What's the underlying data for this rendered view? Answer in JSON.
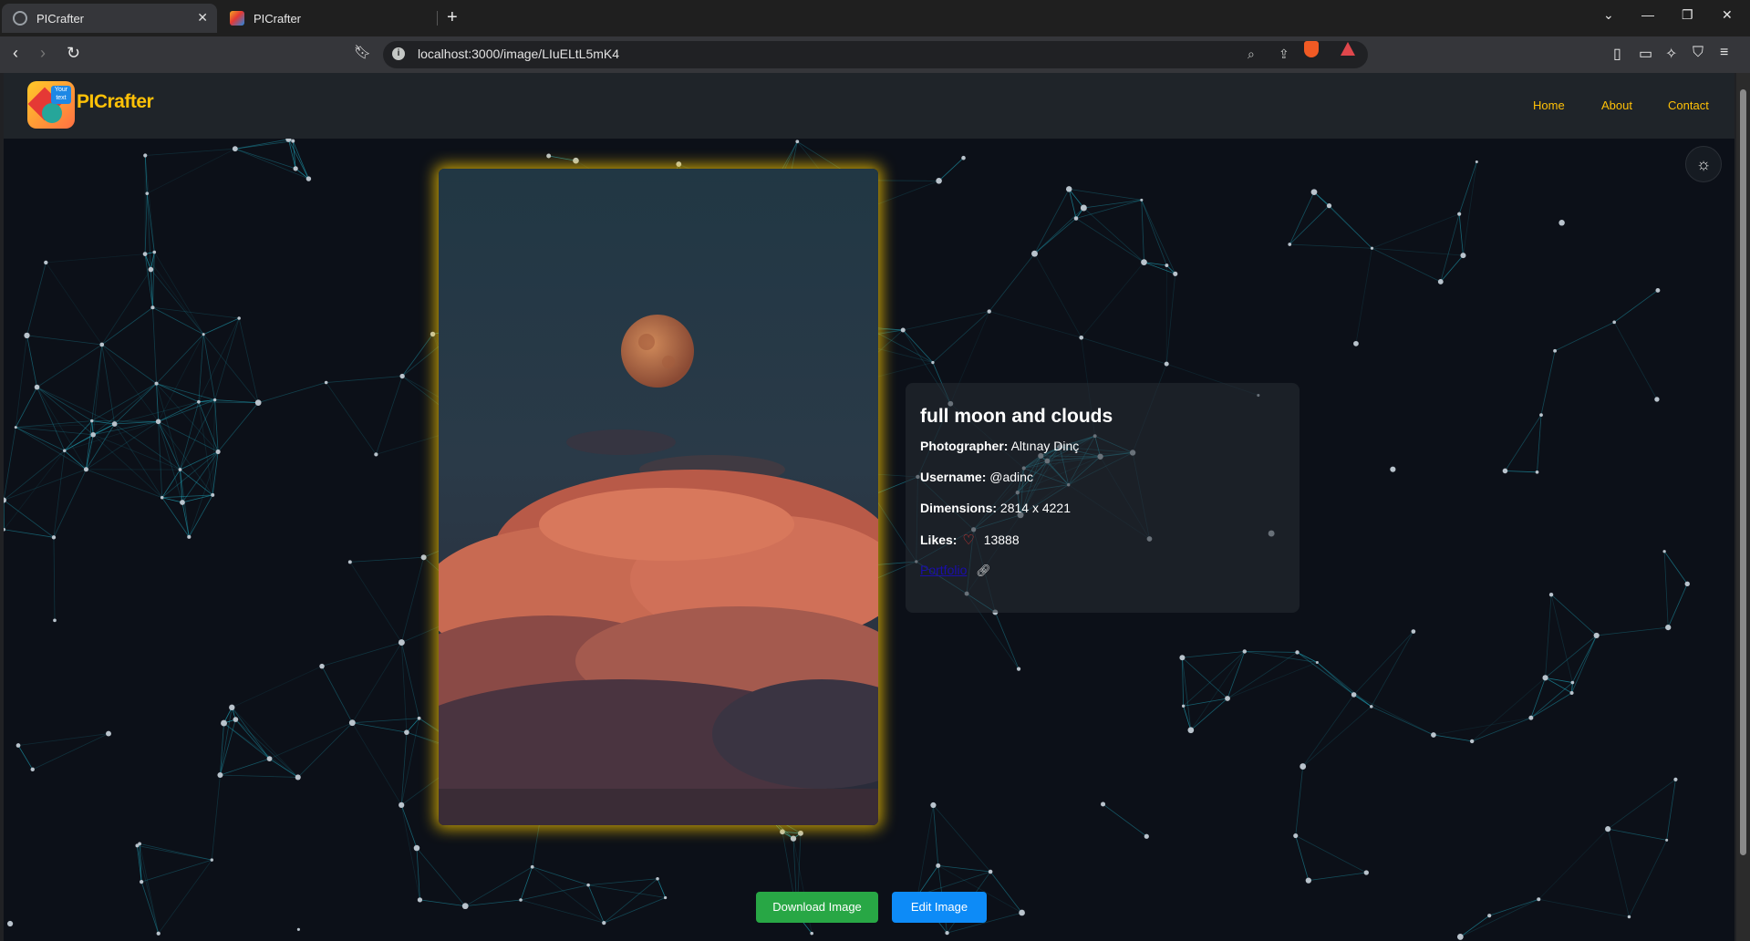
{
  "browser": {
    "tabs": [
      {
        "title": "PICrafter"
      },
      {
        "title": "PICrafter"
      }
    ],
    "url": "localhost:3000/image/LIuELtL5mK4"
  },
  "app": {
    "brand": "PICrafter",
    "logo_text": "Your text",
    "nav": {
      "home": "Home",
      "about": "About",
      "contact": "Contact"
    }
  },
  "image": {
    "title": "full moon and clouds",
    "photographer_label": "Photographer:",
    "photographer": "Altınay Dinç",
    "username_label": "Username:",
    "username": "@adinc",
    "dimensions_label": "Dimensions:",
    "dimensions": "2814 x 4221",
    "likes_label": "Likes:",
    "likes": "13888",
    "portfolio_label": "Portfolio"
  },
  "actions": {
    "download": "Download Image",
    "edit": "Edit Image"
  },
  "colors": {
    "accent": "#ffc107",
    "download": "#28a745",
    "edit": "#0d8bf7",
    "network": "#1fa3b8"
  }
}
